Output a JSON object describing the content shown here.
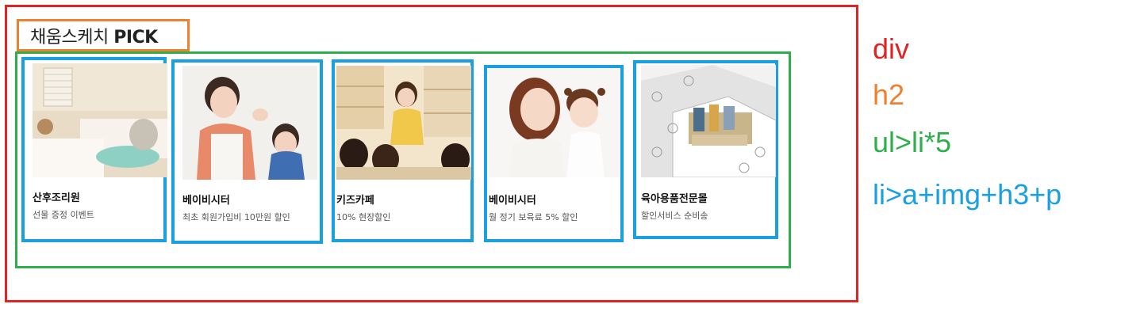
{
  "heading": {
    "main": "채움스케치 ",
    "pick": "PICK"
  },
  "items": [
    {
      "title": "산후조리원",
      "desc": "선물 증정 이벤트"
    },
    {
      "title": "베이비시터",
      "desc": "최초 회원가입비 10만원 할인"
    },
    {
      "title": "키즈카페",
      "desc": "10% 현장할인"
    },
    {
      "title": "베이비시터",
      "desc": "월 정기 보육료 5% 할인"
    },
    {
      "title": "육아용품전문몰",
      "desc": "할인서비스 순비송"
    }
  ],
  "legend": [
    {
      "label": "div",
      "color": "#e02424"
    },
    {
      "label": "h2",
      "color": "#f08030"
    },
    {
      "label": "ul>li*5",
      "color": "#2db04a"
    },
    {
      "label": "li>a+img+h3+p",
      "color": "#1aa0e0"
    }
  ]
}
